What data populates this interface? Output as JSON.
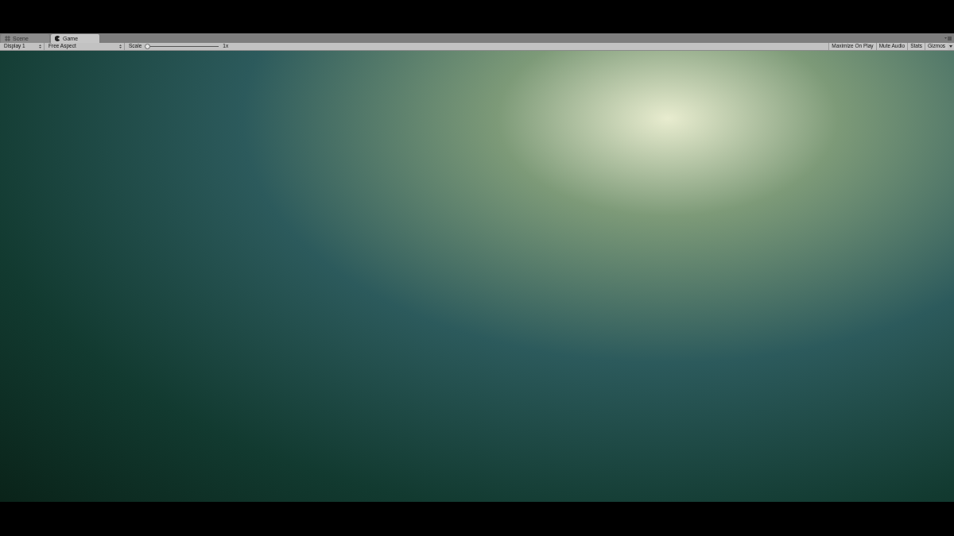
{
  "tabs": [
    {
      "label": "Scene",
      "selected": false,
      "kind": "scene"
    },
    {
      "label": "Game",
      "selected": true,
      "kind": "game"
    }
  ],
  "toolbar": {
    "display": {
      "value": "Display 1"
    },
    "aspect": {
      "value": "Free Aspect"
    },
    "scale": {
      "label": "Scale",
      "level": 0,
      "reading": "1x"
    },
    "toggles": [
      {
        "label": "Maximize On Play",
        "on": false
      },
      {
        "label": "Mute Audio",
        "on": false
      },
      {
        "label": "Stats",
        "on": false
      },
      {
        "label": "Gizmos",
        "on": false
      }
    ]
  }
}
